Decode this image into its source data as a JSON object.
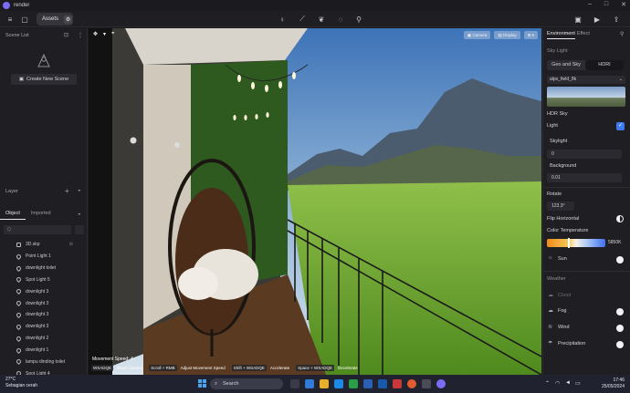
{
  "app": {
    "title": "render"
  },
  "toolbar": {
    "assets_label": "Assets"
  },
  "left": {
    "scene_list_label": "Scene List",
    "create_scene_label": "Create New Scene",
    "layer_label": "Layer",
    "tab_object": "Object",
    "tab_imported": "Imported",
    "search_placeholder": "Q",
    "objects": [
      "3D.skp",
      "Point Light 1",
      "downlight toilet",
      "Spot Light 5",
      "downlight 3",
      "downlight 3",
      "downlight 3",
      "downlight 3",
      "downlight 2",
      "downlight 1",
      "lampu dinding toilet",
      "Spot Light 4"
    ]
  },
  "viewport": {
    "camera_label": "Camera",
    "display_label": "Display",
    "movement_title": "Movement Speed: 4",
    "hints": [
      {
        "key": "WSADQE",
        "desc": "Move Camera"
      },
      {
        "key": "Scroll + RMB",
        "desc": "Adjust Movement Speed"
      },
      {
        "key": "Shift + WSADQE",
        "desc": "Accelerate"
      },
      {
        "key": "Space + WSADQE",
        "desc": "Decelerate"
      }
    ]
  },
  "right": {
    "tab_environment": "Environment",
    "tab_effect": "Effect",
    "sky_light": "Sky Light",
    "geo_sky": "Geo and Sky",
    "hdri": "HDRI",
    "hdri_file": "alps_field_8k",
    "hdr_sky": "HDR Sky",
    "light": "Light",
    "skylight": "Skylight",
    "skylight_value": "0",
    "background": "Background",
    "background_value": "0.01",
    "rotate": "Rotate",
    "rotate_value": "123.3°",
    "flip_horizontal": "Flip Horizontal",
    "color_temperature": "Color Temperature",
    "color_temperature_value": "5850K",
    "sun": "Sun",
    "weather": "Weather",
    "cloud": "Cloud",
    "fog": "Fog",
    "wind": "Wind",
    "precipitation": "Precipitation"
  },
  "taskbar": {
    "temperature": "27°C",
    "weather_desc": "Sebagian cerah",
    "search_label": "Search",
    "time": "17:46",
    "date": "25/05/2024"
  },
  "colors": {
    "accent": "#3d7bf0",
    "panel": "#1f1f23",
    "taskbar": "#202230"
  }
}
